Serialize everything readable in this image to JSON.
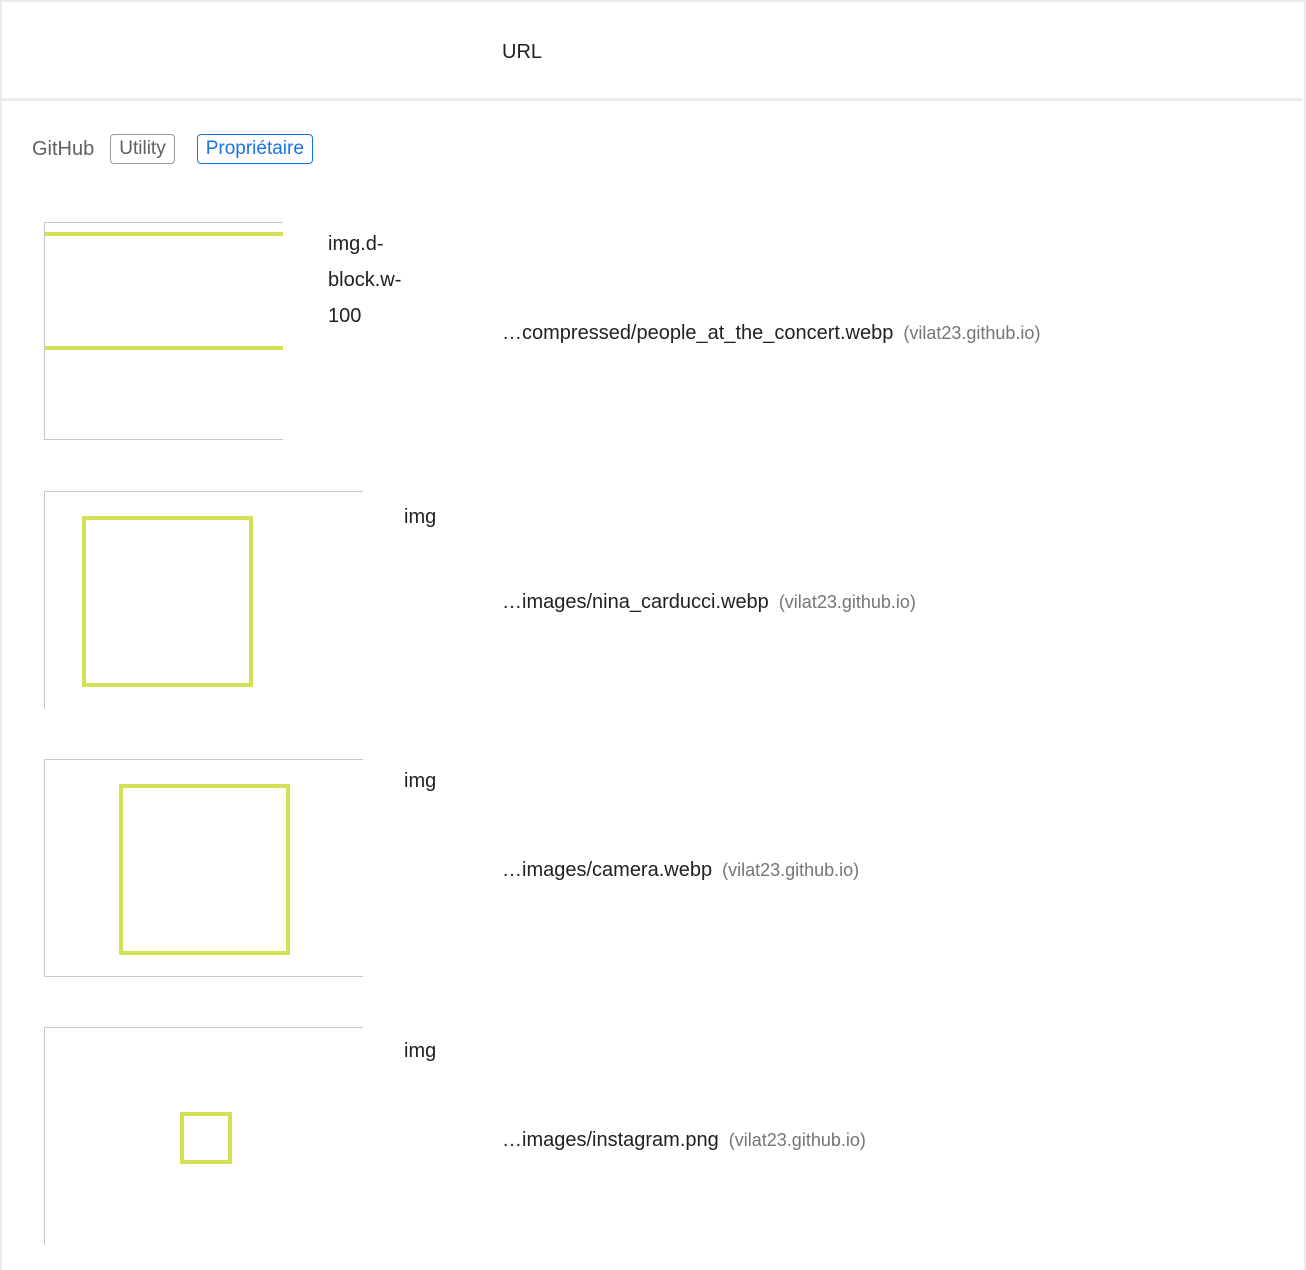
{
  "header": {
    "url_column_label": "URL"
  },
  "group": {
    "name": "GitHub",
    "badges": [
      "Utility",
      "Propriétaire"
    ]
  },
  "rows": [
    {
      "node_label": "img.d-\nblock.w-\n100",
      "url": "…compressed/people_at_the_concert.webp",
      "host": "(vilat23.github.io)"
    },
    {
      "node_label": "img",
      "url": "…images/nina_carducci.webp",
      "host": "(vilat23.github.io)"
    },
    {
      "node_label": "img",
      "url": "…images/camera.webp",
      "host": "(vilat23.github.io)"
    },
    {
      "node_label": "img",
      "url": "…images/instagram.png",
      "host": "(vilat23.github.io)"
    }
  ],
  "colors": {
    "accent": "#d4e157",
    "badge_blue": "#1a73e8",
    "border": "#ebebeb"
  }
}
